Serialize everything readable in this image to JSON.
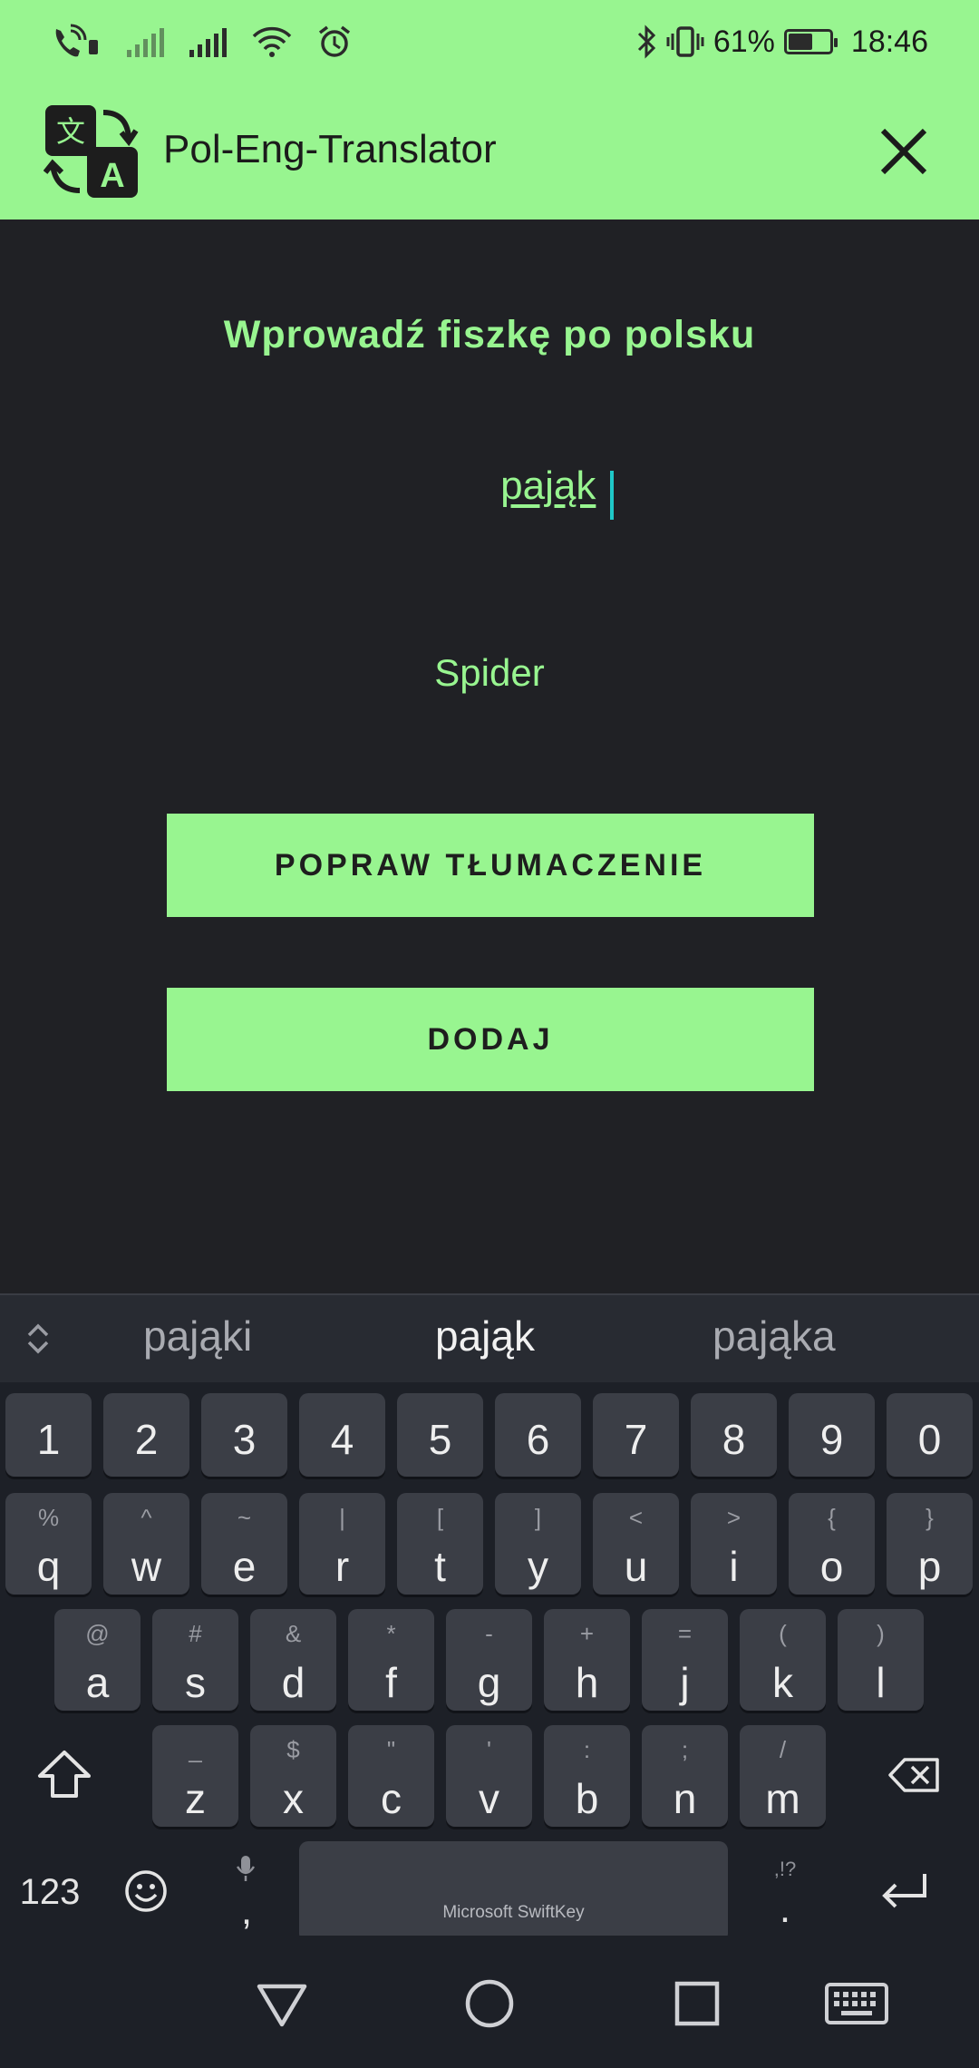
{
  "status_bar": {
    "battery_percent": "61%",
    "battery_level": 0.61,
    "time": "18:46",
    "icons": [
      "wifi-calling-icon",
      "signal-icon",
      "signal-icon",
      "wifi-icon",
      "alarm-icon",
      "bluetooth-icon",
      "vibrate-icon",
      "battery-icon"
    ]
  },
  "app_bar": {
    "title": "Pol-Eng-Translator",
    "logo_icon": "translate-icon",
    "close_icon": "close-icon"
  },
  "main": {
    "heading": "Wprowadź fiszkę po polsku",
    "input_value": "pająk",
    "translation": "Spider",
    "correct_button": "POPRAW TŁUMACZENIE",
    "add_button": "DODAJ"
  },
  "keyboard": {
    "suggestions": [
      "pająki",
      "pająk",
      "pająka"
    ],
    "number_row": [
      "1",
      "2",
      "3",
      "4",
      "5",
      "6",
      "7",
      "8",
      "9",
      "0"
    ],
    "row1": [
      {
        "key": "q",
        "sub": "%"
      },
      {
        "key": "w",
        "sub": "^"
      },
      {
        "key": "e",
        "sub": "~"
      },
      {
        "key": "r",
        "sub": "|"
      },
      {
        "key": "t",
        "sub": "["
      },
      {
        "key": "y",
        "sub": "]"
      },
      {
        "key": "u",
        "sub": "<"
      },
      {
        "key": "i",
        "sub": ">"
      },
      {
        "key": "o",
        "sub": "{"
      },
      {
        "key": "p",
        "sub": "}"
      }
    ],
    "row2": [
      {
        "key": "a",
        "sub": "@"
      },
      {
        "key": "s",
        "sub": "#"
      },
      {
        "key": "d",
        "sub": "&"
      },
      {
        "key": "f",
        "sub": "*"
      },
      {
        "key": "g",
        "sub": "-"
      },
      {
        "key": "h",
        "sub": "+"
      },
      {
        "key": "j",
        "sub": "="
      },
      {
        "key": "k",
        "sub": "("
      },
      {
        "key": "l",
        "sub": ")"
      }
    ],
    "row3": [
      {
        "key": "z",
        "sub": "_"
      },
      {
        "key": "x",
        "sub": "$"
      },
      {
        "key": "c",
        "sub": "\""
      },
      {
        "key": "v",
        "sub": "'"
      },
      {
        "key": "b",
        "sub": ":"
      },
      {
        "key": "n",
        "sub": ";"
      },
      {
        "key": "m",
        "sub": "/"
      }
    ],
    "numbers_key": "123",
    "comma_key": ",",
    "period_key": ".",
    "period_sub": ",!?",
    "space_label": "Microsoft SwiftKey"
  },
  "colors": {
    "accent": "#98f590",
    "background": "#202125",
    "keyboard_bg": "#1d2027",
    "key_bg": "#3b3e46",
    "caret": "#1fc8c8"
  }
}
